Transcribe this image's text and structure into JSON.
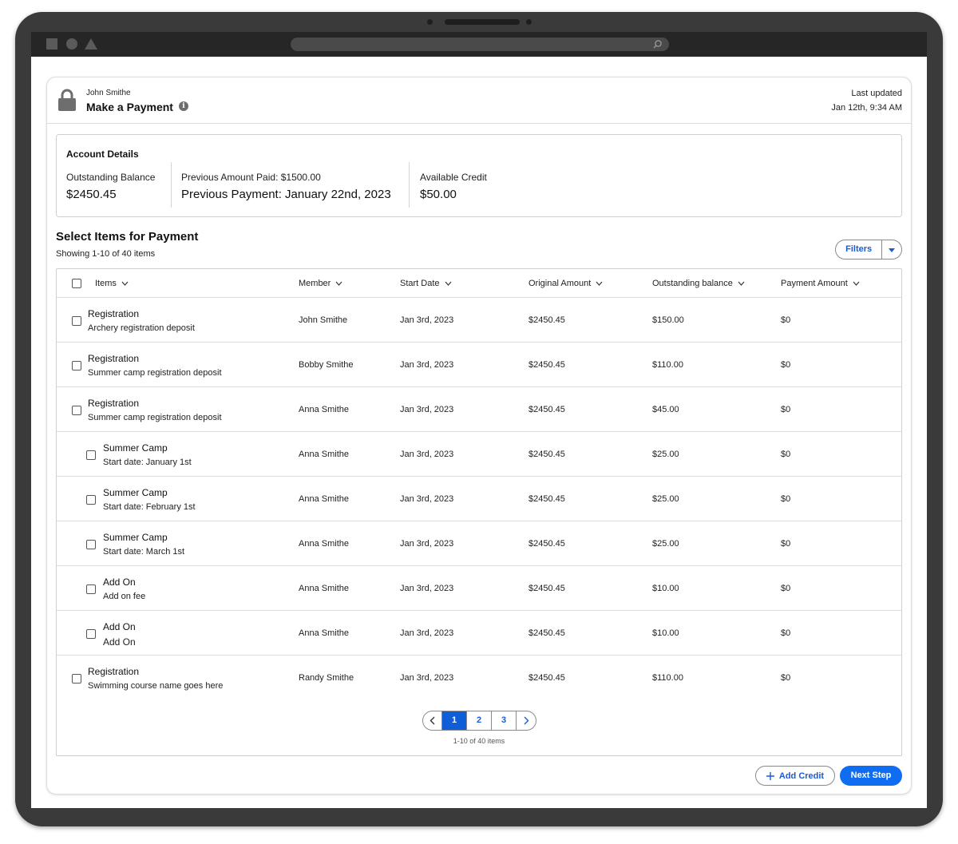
{
  "header": {
    "user_name": "John Smithe",
    "title": "Make a Payment",
    "last_updated_label": "Last updated",
    "last_updated_time": "Jan 12th, 9:34 AM"
  },
  "account": {
    "title": "Account Details",
    "outstanding_label": "Outstanding Balance",
    "outstanding_value": "$2450.45",
    "prev_paid_label": "Previous Amount Paid: $1500.00",
    "prev_payment_value": "Previous Payment: January 22nd, 2023",
    "credit_label": "Available Credit",
    "credit_value": "$50.00"
  },
  "section": {
    "title": "Select Items for Payment",
    "subtitle": "Showing 1-10 of 40 items",
    "filters_label": "Filters"
  },
  "table": {
    "columns": [
      "Items",
      "Member",
      "Start Date",
      "Original Amount",
      "Outstanding balance",
      "Payment Amount"
    ],
    "rows": [
      {
        "title": "Registration",
        "sub": "Archery registration deposit",
        "member": "John Smithe",
        "start": "Jan 3rd, 2023",
        "original": "$2450.45",
        "outstanding": "$150.00",
        "payment": "$0"
      },
      {
        "title": "Registration",
        "sub": "Summer camp registration deposit",
        "member": "Bobby Smithe",
        "start": "Jan 3rd, 2023",
        "original": "$2450.45",
        "outstanding": "$110.00",
        "payment": "$0"
      },
      {
        "title": "Registration",
        "sub": "Summer camp registration deposit",
        "member": "Anna Smithe",
        "start": "Jan 3rd, 2023",
        "original": "$2450.45",
        "outstanding": "$45.00",
        "payment": "$0"
      },
      {
        "title": "Summer Camp",
        "sub": "Start date: January 1st",
        "member": "Anna Smithe",
        "start": "Jan 3rd, 2023",
        "original": "$2450.45",
        "outstanding": "$25.00",
        "payment": "$0"
      },
      {
        "title": "Summer Camp",
        "sub": "Start date: February 1st",
        "member": "Anna Smithe",
        "start": "Jan 3rd, 2023",
        "original": "$2450.45",
        "outstanding": "$25.00",
        "payment": "$0"
      },
      {
        "title": "Summer Camp",
        "sub": "Start date: March 1st",
        "member": "Anna Smithe",
        "start": "Jan 3rd, 2023",
        "original": "$2450.45",
        "outstanding": "$25.00",
        "payment": "$0"
      },
      {
        "title": "Add On",
        "sub": "Add on fee",
        "member": "Anna Smithe",
        "start": "Jan 3rd, 2023",
        "original": "$2450.45",
        "outstanding": "$10.00",
        "payment": "$0"
      },
      {
        "title": "Add On",
        "sub": "Add On",
        "member": "Anna Smithe",
        "start": "Jan 3rd, 2023",
        "original": "$2450.45",
        "outstanding": "$10.00",
        "payment": "$0"
      },
      {
        "title": "Registration",
        "sub": "Swimming course name goes here",
        "member": "Randy Smithe",
        "start": "Jan 3rd, 2023",
        "original": "$2450.45",
        "outstanding": "$110.00",
        "payment": "$0"
      }
    ]
  },
  "pagination": {
    "pages": [
      "1",
      "2",
      "3"
    ],
    "current": "1",
    "info": "1-10 of 40 items"
  },
  "actions": {
    "add_credit": "Add Credit",
    "next_step": "Next Step"
  },
  "colors": {
    "primary": "#0f6df2",
    "link": "#1a5ad6",
    "device": "#3a3a3a"
  },
  "icons": [
    "lock-icon",
    "info-icon",
    "search-icon",
    "chevron-down-icon",
    "caret-down-icon",
    "chevron-left-icon",
    "chevron-right-icon",
    "plus-icon"
  ]
}
